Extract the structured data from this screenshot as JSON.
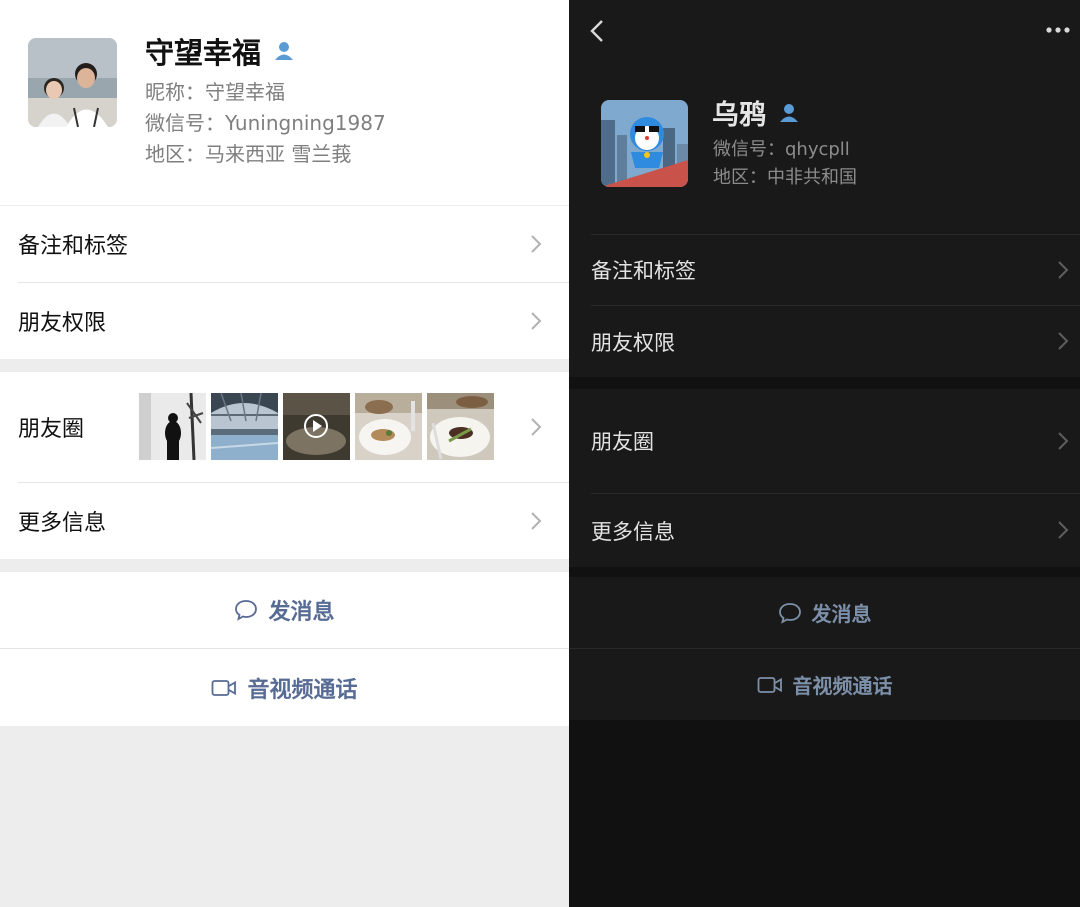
{
  "light": {
    "name": "守望幸福",
    "nickname": "昵称：守望幸福",
    "wechat_id": "微信号：Yuningning1987",
    "region": "地区：马来西亚 雪兰莪",
    "rows": {
      "notes": "备注和标签",
      "permissions": "朋友权限",
      "moments": "朋友圈",
      "more_info": "更多信息"
    },
    "actions": {
      "message": "发消息",
      "call": "音视频通话"
    }
  },
  "dark": {
    "name": "乌鸦",
    "wechat_id": "微信号：qhycpll",
    "region": "地区：中非共和国",
    "rows": {
      "notes": "备注和标签",
      "permissions": "朋友权限",
      "moments": "朋友圈",
      "more_info": "更多信息"
    },
    "actions": {
      "message": "发消息",
      "call": "音视频通话"
    }
  },
  "icons": {
    "back": "chevron-left-icon",
    "more": "more-dots-icon",
    "person": "person-icon",
    "chevron": "chevron-right-icon",
    "message": "chat-bubble-icon",
    "call": "video-camera-icon",
    "play": "play-icon"
  },
  "colors": {
    "link_light": "#576b95",
    "link_dark": "#7d90a9",
    "person_icon": "#5b9bd5"
  }
}
